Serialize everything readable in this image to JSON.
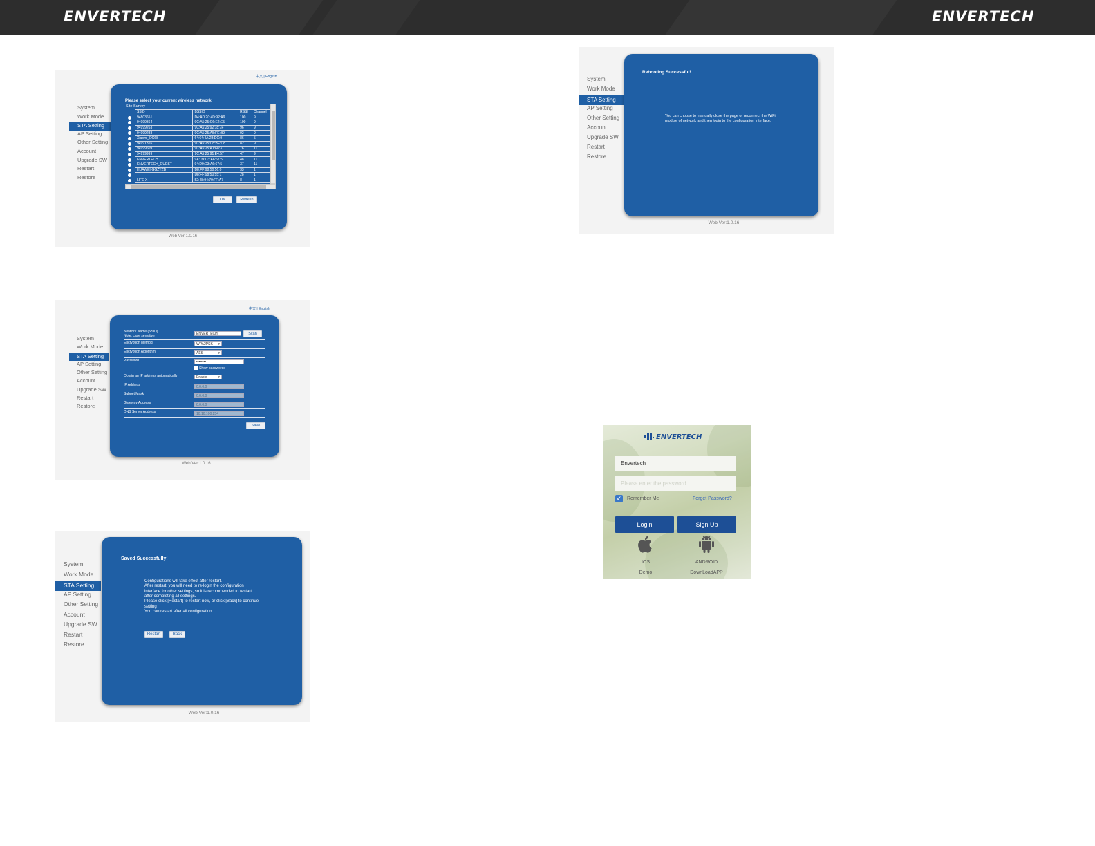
{
  "header": {
    "brand_left": "ENVERTECH",
    "brand_right": "ENVERTECH",
    "background": "#2d2d2d"
  },
  "menu": {
    "items": [
      "System",
      "Work Mode",
      "STA Setting",
      "AP Setting",
      "Other Setting",
      "Account",
      "Upgrade SW",
      "Restart",
      "Restore"
    ],
    "active": "STA Setting"
  },
  "lang": {
    "chinese": "中文",
    "sep": "|",
    "english": "English"
  },
  "version": "Web Ver:1.0.16",
  "colors": {
    "panel": "#1f5fa5",
    "button": "#1d4f96",
    "check": "#3a78c8"
  },
  "survey": {
    "title": "Please select your current wireless network",
    "subtitle": "Site Survey",
    "headers": [
      "SSID",
      "BSSID",
      "RSSI",
      "Channel"
    ],
    "rows": [
      [
        "94803651",
        "D4:AD:20:4D:92:A9",
        "100",
        "9"
      ],
      [
        "94999364",
        "9C:A5:25:C6:E2:E5",
        "100",
        "9"
      ],
      [
        "94999263",
        "9C:A5:25:92:18:7F",
        "96",
        "9"
      ],
      [
        "94999288",
        "9C:A5:25:A8:FE:B9",
        "92",
        "9"
      ],
      [
        "Xiaomi_DC68",
        "64:64:4A:23:DC:9",
        "86",
        "5"
      ],
      [
        "94991316",
        "9C:A5:25:C8:BE:C8",
        "82",
        "9"
      ],
      [
        "94999609",
        "9C:A5:25:A1:68:3",
        "76",
        "11"
      ],
      [
        "94999999",
        "9C:A5:25:91:E4:57",
        "47",
        "9"
      ],
      [
        "ENVERTECH",
        "9A:D9:D3:A6:67:5",
        "48",
        "11"
      ],
      [
        "ENVERTECH_GUEST",
        "94:D9:D3:A6:67:5",
        "37",
        "11"
      ],
      [
        "HUAWEI-GGZYZB",
        "D8:FF:98:50:56:0",
        "33",
        "1"
      ],
      [
        "",
        "D8:FF:98:50:55:1",
        "28",
        "1"
      ],
      [
        "LIFE X",
        "52:48:94:79:FF:A7",
        "8",
        "1"
      ]
    ],
    "ok": "OK",
    "refresh": "Refresh"
  },
  "rebooting": {
    "title": "Rebooting Successful!",
    "text": "You can choose to manually close the page or reconnect the WiFi module of network and then login to the configuration interface."
  },
  "sta_form": {
    "ssid_label": "Network Name (SSID)",
    "ssid_note": "Note: case sensitive",
    "ssid_value": "ENVERTECH",
    "scan": "Scan",
    "encryption_method_label": "Encryption Method",
    "encryption_method_value": "WPA2PSK",
    "encryption_algorithm_label": "Encryption Algorithm",
    "encryption_algorithm_value": "AES",
    "password_label": "Password",
    "password_value": "••••••••",
    "show_password": "Show passwords",
    "dhcp_label": "Obtain an IP address automatically",
    "dhcp_value": "Enable",
    "ip_label": "IP Address",
    "ip_value": "0.0.0.0",
    "mask_label": "Subnet Mask",
    "mask_value": "0.0.0.0",
    "gateway_label": "Gateway Address",
    "gateway_value": "0.0.0.0",
    "dns_label": "DNS Server Address",
    "dns_value": "10.10.100.254",
    "save": "Save"
  },
  "saved": {
    "title": "Saved Successfully!",
    "lines": [
      "Configurations will take effect after restart.",
      "After restart, you will need to re-login the configuration",
      "interface for other settings, so it is recommended to restart",
      "after completing all settings.",
      "Please click [Restart] to restart now, or click [Back] to continue",
      "setting",
      "You can restart after all configuration"
    ],
    "restart": "Restart",
    "back": "Back"
  },
  "login": {
    "brand": "ENVERTECH",
    "username_value": "Envertech",
    "password_placeholder": "Please enter the password",
    "remember": "Remember Me",
    "forget": "Forget Password?",
    "login": "Login",
    "signup": "Sign Up",
    "ios": "IOS",
    "android": "ANDROID",
    "demo": "Demo",
    "download": "DownLoadAPP"
  }
}
